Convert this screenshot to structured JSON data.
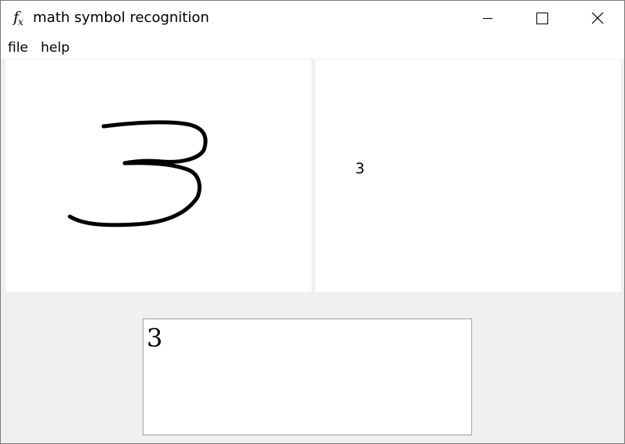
{
  "window": {
    "title": "math symbol recognition",
    "icon": {
      "name": "fx-icon",
      "main": "f",
      "sub": "x"
    }
  },
  "menu": {
    "items": [
      {
        "label": "file"
      },
      {
        "label": "help"
      }
    ]
  },
  "input_canvas": {
    "content": "handwritten 3 stroke"
  },
  "output_canvas": {
    "symbol": "3"
  },
  "result": {
    "latex": "3"
  },
  "colors": {
    "background": "#f0f0f0",
    "pane": "#ffffff",
    "ink": "#000000",
    "border": "#a0a0a0"
  }
}
